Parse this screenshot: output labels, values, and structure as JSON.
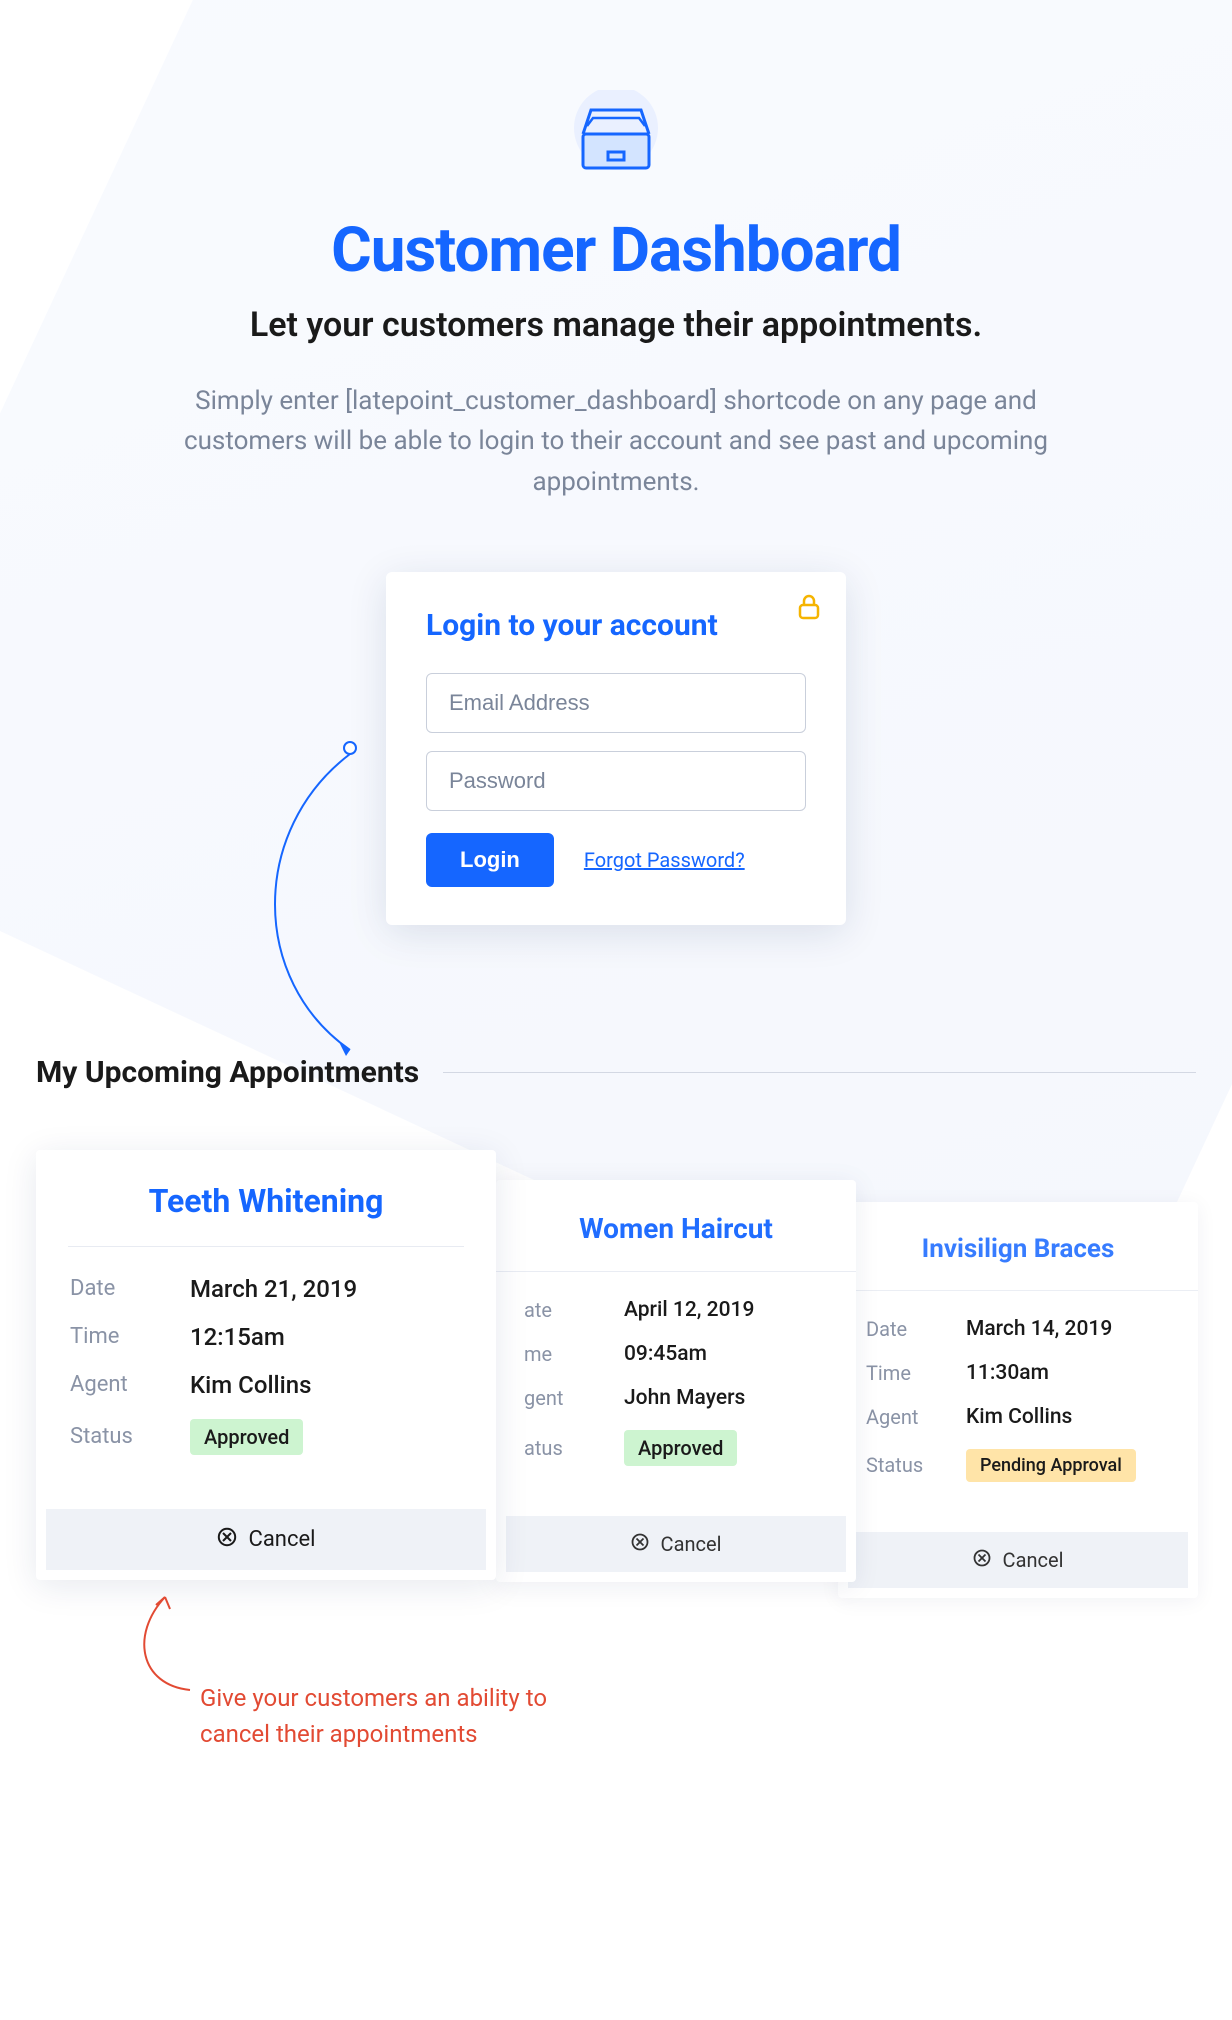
{
  "hero": {
    "title": "Customer Dashboard",
    "subtitle": "Let your customers manage their appointments.",
    "description": "Simply enter [latepoint_customer_dashboard] shortcode on any page and customers will be able to login to their account and see past and upcoming appointments."
  },
  "login": {
    "title": "Login to your account",
    "email_placeholder": "Email Address",
    "password_placeholder": "Password",
    "button_label": "Login",
    "forgot_label": "Forgot Password?"
  },
  "upcoming": {
    "heading": "My Upcoming Appointments",
    "labels": {
      "date": "Date",
      "time": "Time",
      "agent": "Agent",
      "status": "Status"
    },
    "cancel_label": "Cancel",
    "cards": [
      {
        "title": "Teeth Whitening",
        "date": "March 21, 2019",
        "time": "12:15am",
        "agent": "Kim Collins",
        "status": "Approved",
        "status_type": "approved"
      },
      {
        "title": "Women Haircut",
        "date": "April 12, 2019",
        "time": "09:45am",
        "agent": "John Mayers",
        "status": "Approved",
        "status_type": "approved"
      },
      {
        "title": "Invisilign Braces",
        "date": "March 14, 2019",
        "time": "11:30am",
        "agent": "Kim Collins",
        "status": "Pending Approval",
        "status_type": "pending"
      }
    ]
  },
  "annotation": {
    "text": "Give your customers an ability to cancel their appointments"
  }
}
